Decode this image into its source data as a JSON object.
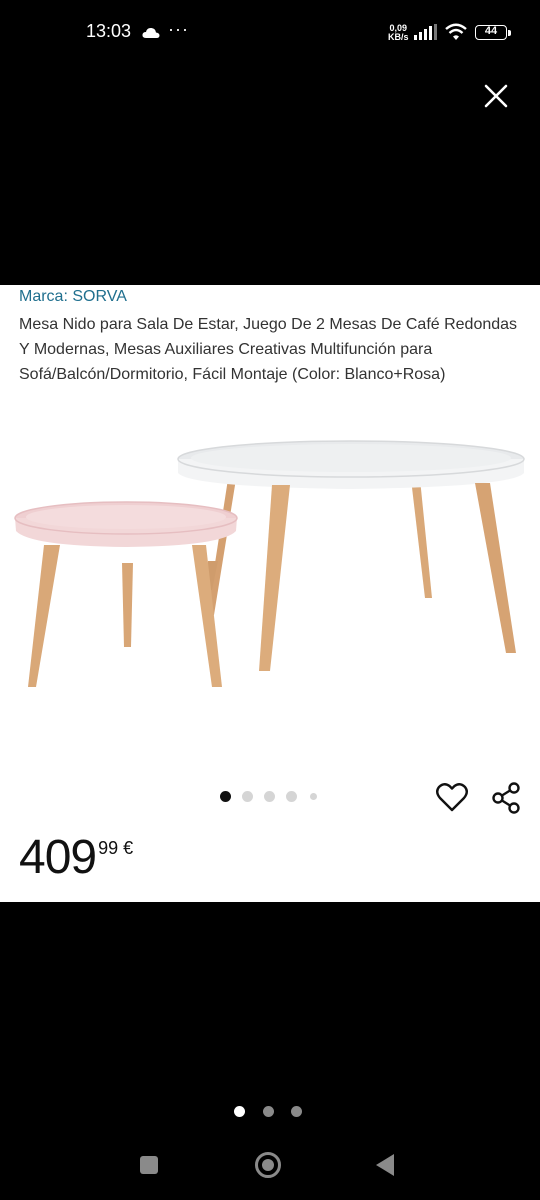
{
  "status_bar": {
    "time": "13:03",
    "more": "···",
    "net_speed_value": "0,09",
    "net_speed_unit": "KB/s",
    "battery": "44"
  },
  "product": {
    "brand": "Marca: SORVA",
    "title": "Mesa Nido para Sala De Estar, Juego De 2 Mesas De Café Redondas Y Modernas, Mesas Auxiliares Creativas Multifunción para Sofá/Balcón/Dormitorio, Fácil Montaje (Color: Blanco+Rosa)",
    "price_whole": "409",
    "price_fraction": "99 €"
  },
  "image_carousel": {
    "total": 5,
    "active_index": 0
  },
  "page_indicator": {
    "total": 3,
    "active_index": 0
  },
  "icons": {
    "close": "close-icon",
    "wishlist": "heart-icon",
    "share": "share-icon"
  },
  "colors": {
    "brand_link": "#1f6f8e",
    "background": "#000000",
    "card": "#ffffff",
    "table_white": "#eef0f1",
    "table_pink": "#f3d9da",
    "wood": "#d9a878"
  }
}
